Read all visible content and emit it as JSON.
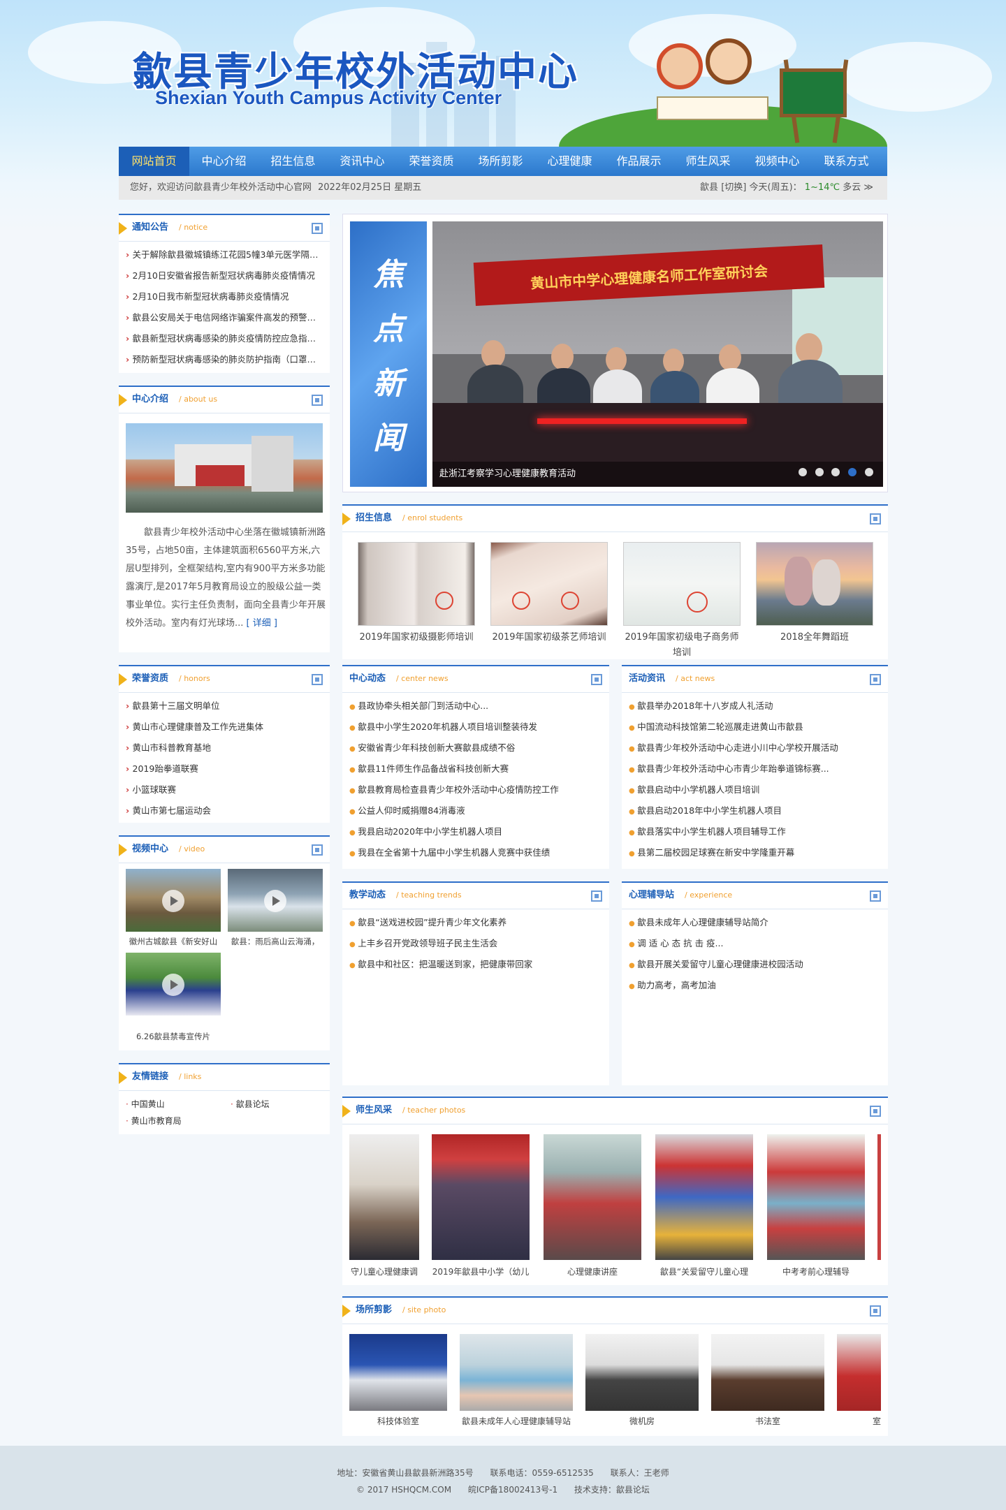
{
  "header": {
    "title_cn": "歙县青少年校外活动中心",
    "title_en": "Shexian Youth Campus Activity Center"
  },
  "nav": {
    "items": [
      "网站首页",
      "中心介绍",
      "招生信息",
      "资讯中心",
      "荣誉资质",
      "场所剪影",
      "心理健康",
      "作品展示",
      "师生风采",
      "视频中心",
      "联系方式"
    ],
    "active": 0
  },
  "subbar": {
    "welcome": "您好，欢迎访问歙县青少年校外活动中心官网",
    "date": "2022年02月25日 星期五",
    "city": "歙县",
    "switch": "[切换]",
    "today": "今天(周五)：",
    "temp": "1~14℃",
    "cond": "多云 ≫"
  },
  "notice": {
    "title": "通知公告",
    "en": "/ notice",
    "items": [
      "关于解除歙县徽城镇练江花园5幢3单元医学隔离...",
      "2月10日安徽省报告新型冠状病毒肺炎疫情情况",
      "2月10日我市新型冠状病毒肺炎疫情情况",
      "歙县公安局关于电信网络诈骗案件高发的预警通报",
      "歙县新型冠状病毒感染的肺炎疫情防控应急指挥...",
      "预防新型冠状病毒感染的肺炎防护指南（口罩使..."
    ]
  },
  "about": {
    "title": "中心介绍",
    "en": "/ about us",
    "text": "歙县青少年校外活动中心坐落在徽城镇新洲路35号，占地50亩，主体建筑面积6560平方米,六层U型排列，全框架结构,室内有900平方米多功能露演厅,是2017年5月教育局设立的股级公益一类事业单位。实行主任负责制，面向全县青少年开展校外活动。室内有灯光球场...",
    "more": "[ 详细 ]"
  },
  "honors": {
    "title": "荣誉资质",
    "en": "/ honors",
    "items": [
      "歙县第十三届文明单位",
      "黄山市心理健康普及工作先进集体",
      "黄山市科普教育基地",
      "2019跆拳道联赛",
      "小篮球联赛",
      "黄山市第七届运动会"
    ]
  },
  "video": {
    "title": "视频中心",
    "en": "/ video",
    "items": [
      "徽州古城歙县《新安好山",
      "歙县：雨后高山云海涌，",
      "6.26歙县禁毒宣传片"
    ]
  },
  "links": {
    "title": "友情链接",
    "en": "/ links",
    "items": [
      "中国黄山",
      "歙县论坛",
      "黄山市教育局"
    ]
  },
  "focus": {
    "side": [
      "焦",
      "点",
      "新",
      "闻"
    ],
    "banner": "黄山市中学心理健康名师工作室研讨会",
    "caption": "赴浙江考察学习心理健康教育活动",
    "active_dot": 3
  },
  "enrol": {
    "title": "招生信息",
    "en": "/ enrol students",
    "items": [
      "2019年国家初级摄影师培训",
      "2019年国家初级茶艺师培训",
      "2019年国家初级电子商务师培训",
      "2018全年舞蹈班"
    ]
  },
  "cnews": {
    "title": "中心动态",
    "en": "/ center news",
    "items": [
      "县政协牵头相关部门到活动中心...",
      "歙县中小学生2020年机器人项目培训整装待发",
      "安徽省青少年科技创新大赛歙县成绩不俗",
      "歙县11件师生作品备战省科技创新大赛",
      "歙县教育局检查县青少年校外活动中心疫情防控工作",
      "公益人仰时威捐赠84消毒液",
      "我县启动2020年中小学生机器人项目",
      "我县在全省第十九届中小学生机器人竞赛中获佳绩"
    ]
  },
  "anews": {
    "title": "活动资讯",
    "en": "/ act news",
    "items": [
      "歙县举办2018年十八岁成人礼活动",
      "中国流动科技馆第二轮巡展走进黄山市歙县",
      "歙县青少年校外活动中心走进小川中心学校开展活动",
      "歙县青少年校外活动中心市青少年跆拳道锦标赛...",
      "歙县启动中小学机器人项目培训",
      "歙县启动2018年中小学生机器人项目",
      "歙县落实中小学生机器人项目辅导工作",
      "县第二届校园足球赛在新安中学隆重开幕"
    ]
  },
  "teach": {
    "title": "教学动态",
    "en": "/ teaching trends",
    "items": [
      "歙县“送戏进校园”提升青少年文化素养",
      "上丰乡召开党政领导班子民主生活会",
      "歙县中和社区：把温暖送到家，把健康带回家"
    ]
  },
  "psy": {
    "title": "心理辅导站",
    "en": "/ experience",
    "items": [
      "歙县未成年人心理健康辅导站简介",
      "调 适 心 态 抗 击 疫...",
      "歙县开展关爱留守儿童心理健康进校园活动",
      "助力高考，高考加油"
    ]
  },
  "teacher": {
    "title": "师生风采",
    "en": "/ teacher photos",
    "items": [
      "守儿童心理健康调",
      "2019年歙县中小学（幼儿",
      "心理健康讲座",
      "歙县“关爱留守儿童心理",
      "中考考前心理辅导"
    ]
  },
  "site": {
    "title": "场所剪影",
    "en": "/ site photo",
    "items": [
      "科技体验室",
      "歙县未成年人心理健康辅导站",
      "微机房",
      "书法室",
      "室"
    ]
  },
  "footer": {
    "address": "地址：安徽省黄山县歙县新洲路35号",
    "phone": "联系电话：0559-6512535",
    "contact": "联系人：王老师",
    "copy": "© 2017 HSHQCM.COM",
    "icp": "皖ICP备18002413号-1",
    "support": "技术支持：歙县论坛"
  },
  "colors": {
    "nav": "#2b78cd",
    "accent": "#f0b21a",
    "title": "#1c5fb7"
  }
}
